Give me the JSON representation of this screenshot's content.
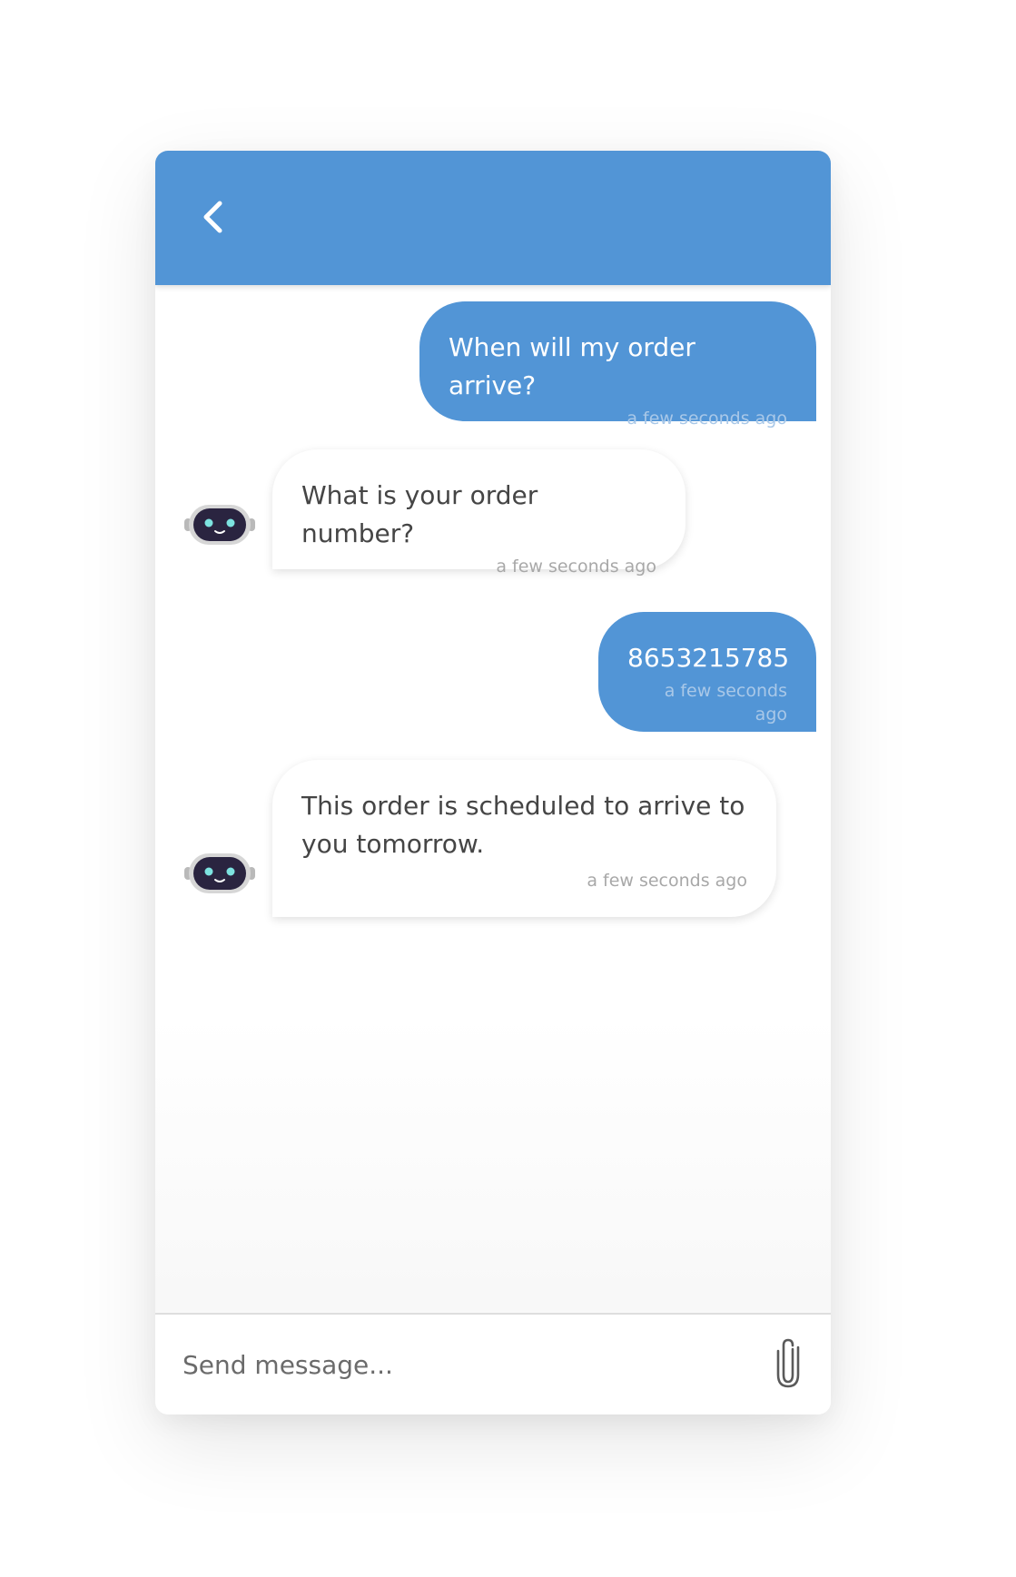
{
  "header": {
    "back_icon": "chevron-left-icon",
    "background_color": "#5295d6"
  },
  "messages": [
    {
      "sender": "user",
      "text": "When will my order arrive?",
      "time": "a few seconds ago"
    },
    {
      "sender": "bot",
      "text": "What is your order number?",
      "time": "a few seconds ago"
    },
    {
      "sender": "user",
      "text": "8653215785",
      "time": "a few seconds ago"
    },
    {
      "sender": "bot",
      "text": "This order is scheduled to arrive to\nyou tomorrow.",
      "time": "a few seconds ago"
    }
  ],
  "bot_avatar_icon": "robot-avatar-icon",
  "composer": {
    "placeholder": "Send message...",
    "value": "",
    "attach_icon": "paperclip-icon"
  },
  "colors": {
    "accent": "#5295d6",
    "bot_bubble": "#ffffff",
    "bot_text": "#454545"
  }
}
